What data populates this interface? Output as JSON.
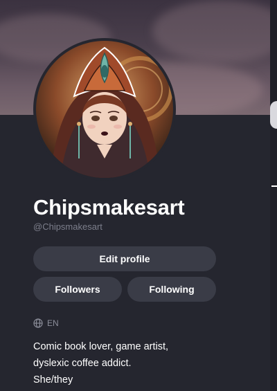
{
  "profile": {
    "display_name": "Chipsmakesart",
    "handle": "@Chipsmakesart",
    "language": "EN",
    "bio_lines": [
      "Comic book lover, game artist,",
      "dyslexic coffee addict.",
      "She/they"
    ]
  },
  "actions": {
    "edit_profile_label": "Edit profile",
    "followers_label": "Followers",
    "following_label": "Following"
  },
  "icons": {
    "language": "globe-icon"
  },
  "colors": {
    "background": "#25262f",
    "button": "#3a3c47",
    "muted_text": "#7d7f8c"
  }
}
